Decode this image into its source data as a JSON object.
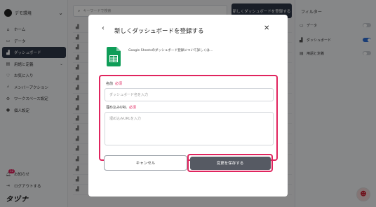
{
  "sidebar": {
    "workspace_name": "デモ環境",
    "nav": [
      {
        "label": "ホーム",
        "icon": "home-icon"
      },
      {
        "label": "データ",
        "icon": "folder-icon"
      },
      {
        "label": "ダッシュボード",
        "icon": "chart-icon",
        "active": true
      },
      {
        "label": "用語と定義",
        "icon": "book-icon",
        "has_chevron": true
      },
      {
        "label": "お気に入り",
        "icon": "heart-icon"
      },
      {
        "label": "メンバーアクション",
        "icon": "bolt-icon"
      },
      {
        "label": "ワークスペース設定",
        "icon": "gear-icon"
      },
      {
        "label": "個人設定",
        "icon": "user-icon"
      }
    ],
    "notifications_label": "お知らせ",
    "notifications_badge": "12",
    "logout_label": "ログアウトする",
    "logo_text": "タヅナ"
  },
  "main": {
    "search_placeholder": "キーワードで検索",
    "register_button": "新しくダッシュボードを登録する"
  },
  "filter": {
    "title": "フィルター",
    "items": [
      {
        "label": "データ",
        "on": false
      },
      {
        "label": "ダッシュボード",
        "on": true
      },
      {
        "label": "用語と定義",
        "on": false
      }
    ]
  },
  "modal": {
    "title": "新しくダッシュボードを登録する",
    "info_text": "Google Sheetsのダッシュボード登録について詳しくは…",
    "name_label": "名前",
    "name_required": "必須",
    "name_placeholder": "ダッシュボード名を入力",
    "url_label": "埋め込みURL",
    "url_required": "必須",
    "url_placeholder": "埋め込みURLを入力",
    "cancel_label": "キャンセル",
    "save_label": "変更を保存する"
  },
  "colors": {
    "accent": "#e0245e",
    "primary_dark": "#2f3747",
    "toggle_on": "#2e6fd8",
    "sheets_green": "#0f9d58"
  }
}
